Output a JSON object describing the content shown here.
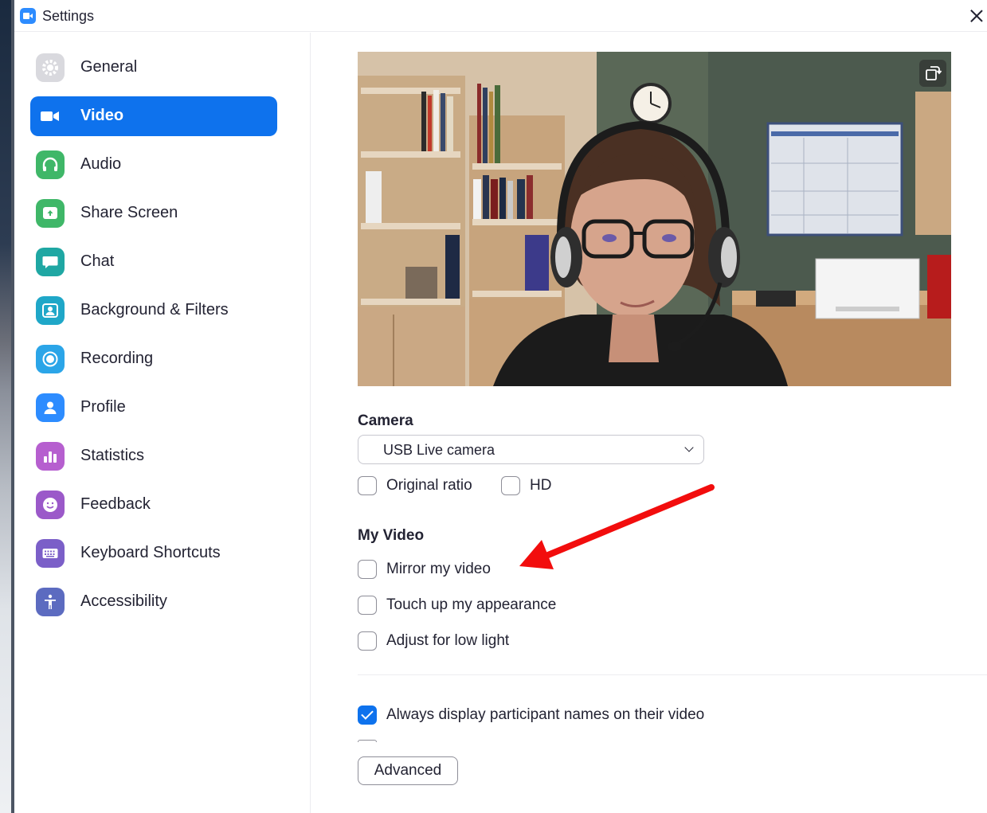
{
  "window": {
    "title": "Settings"
  },
  "sidebar": {
    "items": [
      {
        "label": "General",
        "icon": "gear-icon",
        "color": "#d9d9de",
        "active": false
      },
      {
        "label": "Video",
        "icon": "video-camera-icon",
        "color": "#0e72ed",
        "active": true
      },
      {
        "label": "Audio",
        "icon": "headphones-icon",
        "color": "#3fb768",
        "active": false
      },
      {
        "label": "Share Screen",
        "icon": "share-screen-icon",
        "color": "#3fb768",
        "active": false
      },
      {
        "label": "Chat",
        "icon": "chat-bubble-icon",
        "color": "#1fa7a3",
        "active": false
      },
      {
        "label": "Background & Filters",
        "icon": "person-portrait-icon",
        "color": "#1fa7c8",
        "active": false
      },
      {
        "label": "Recording",
        "icon": "record-icon",
        "color": "#2ba5e8",
        "active": false
      },
      {
        "label": "Profile",
        "icon": "person-icon",
        "color": "#2d8cff",
        "active": false
      },
      {
        "label": "Statistics",
        "icon": "bar-chart-icon",
        "color": "#b65fcf",
        "active": false
      },
      {
        "label": "Feedback",
        "icon": "smiley-icon",
        "color": "#9b59c9",
        "active": false
      },
      {
        "label": "Keyboard Shortcuts",
        "icon": "keyboard-icon",
        "color": "#7b5fc8",
        "active": false
      },
      {
        "label": "Accessibility",
        "icon": "accessibility-icon",
        "color": "#5c6bc0",
        "active": false
      }
    ]
  },
  "video": {
    "camera_heading": "Camera",
    "camera_select_value": "USB  Live camera",
    "original_ratio": {
      "label": "Original ratio",
      "checked": false
    },
    "hd": {
      "label": "HD",
      "checked": false
    },
    "my_video_heading": "My Video",
    "mirror": {
      "label": "Mirror my video",
      "checked": false
    },
    "touch_up": {
      "label": "Touch up my appearance",
      "checked": false
    },
    "low_light": {
      "label": "Adjust for low light",
      "checked": false
    },
    "participant_names": {
      "label": "Always display participant names on their video",
      "checked": true
    },
    "advanced_button": "Advanced"
  },
  "annotation": {
    "arrow_color": "#f20d0d"
  }
}
